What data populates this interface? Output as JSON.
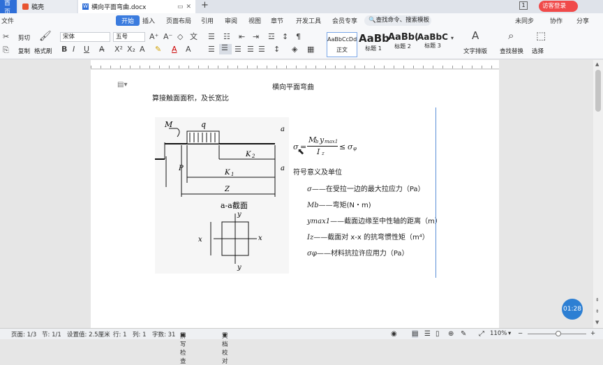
{
  "tabs": {
    "home": "首页",
    "draft": "稿壳",
    "doc": "横向平面弯曲.docx",
    "new": "+"
  },
  "titlebar": {
    "badge": "1",
    "login": "访客登录"
  },
  "menu": {
    "file": "文件",
    "start": "开始",
    "insert": "插入",
    "layout": "页面布局",
    "ref": "引用",
    "review": "审阅",
    "view": "视图",
    "chapter": "章节",
    "dev": "开发工具",
    "member": "会员专享",
    "search": "查找命令、搜索模板",
    "sync": "未同步",
    "collab": "协作",
    "share": "分享"
  },
  "toolbar": {
    "cut": "剪切",
    "copy": "复制",
    "painter": "格式刷",
    "font": "宋体",
    "size": "五号",
    "bold": "B",
    "italic": "I",
    "underline": "U",
    "font_color": "A",
    "text_layout": "文字排版",
    "find": "查找替换",
    "select": "选择"
  },
  "styles": [
    {
      "preview": "AaBbCcDd",
      "name": "正文"
    },
    {
      "preview": "AaBb",
      "name": "标题 1"
    },
    {
      "preview": "AaBb(",
      "name": "标题 2"
    },
    {
      "preview": "AaBbC(",
      "name": "标题 3"
    }
  ],
  "doc": {
    "heading": "横向平面弯曲",
    "intro": "算接触面面积，及长宽比",
    "fig": {
      "M": "M",
      "q": "q",
      "a": "a",
      "P": "P",
      "K2": "K",
      "K2s": "2",
      "K1": "K",
      "K1s": "1",
      "Z": "Z",
      "section": "a-a截面",
      "y": "y",
      "x": "x"
    },
    "formula": {
      "sigma": "σ",
      "mb": "M",
      "mbs": "b",
      "ymax": "y",
      "ymaxs": "max1",
      "iz": "I",
      "izs": "z",
      "le": "≤",
      "sp": "σ",
      "sps": "φ"
    },
    "legend_title": "符号意义及单位",
    "legend": [
      {
        "sym": "σ",
        "text": "在受拉一边的最大拉应力（Pa）"
      },
      {
        "sym": "Mb",
        "text": "弯矩(N・m)"
      },
      {
        "sym": "ymax1",
        "text": "截面边缘至中性轴的距离（m）"
      },
      {
        "sym": "Iz",
        "text": "截面对 x-x 的抗弯惯性矩（m⁴）"
      },
      {
        "sym": "σφ",
        "text": "材料抗拉许应用力（Pa）"
      }
    ]
  },
  "timer": "01:28",
  "status": {
    "page": "页面: 1/3",
    "section": "节: 1/1",
    "setting": "设置值: 2.5厘米",
    "row": "行: 1",
    "col": "列: 1",
    "words": "字数: 31",
    "spell": "拼写检查",
    "proof": "文档校对",
    "zoom": "110%"
  },
  "colors": {
    "accent": "#3a7bde",
    "tab_blue": "#2f6fd8",
    "timer": "#2d7fd3"
  }
}
